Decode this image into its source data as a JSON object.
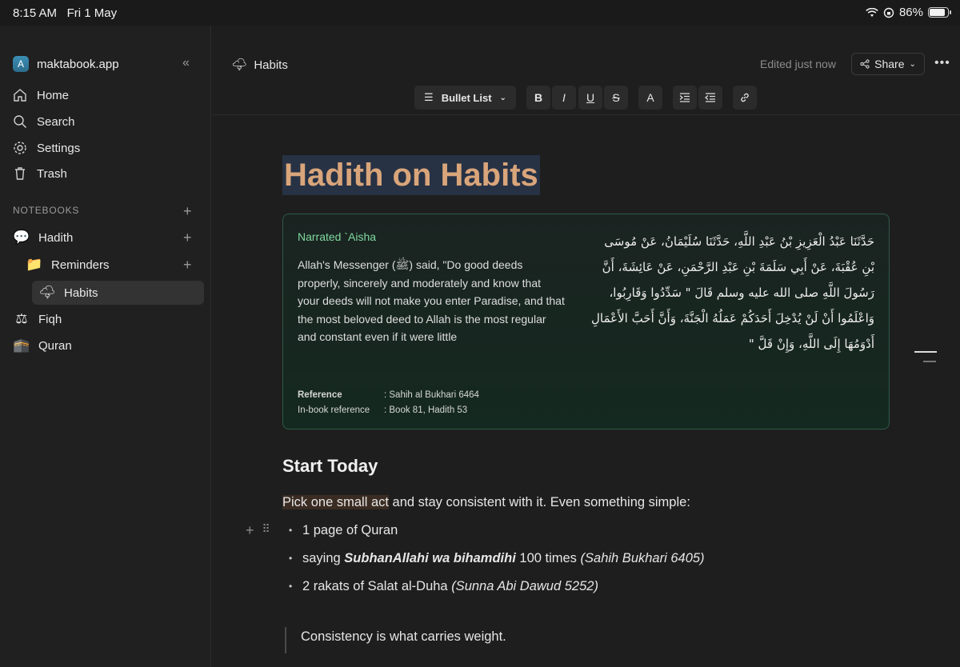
{
  "status": {
    "time": "8:15 AM",
    "date": "Fri 1 May",
    "battery": "86%",
    "battery_level": 0.86
  },
  "sidebar": {
    "workspace_initial": "A",
    "workspace_name": "maktabook.app",
    "nav": [
      {
        "label": "Home",
        "icon": "home-icon"
      },
      {
        "label": "Search",
        "icon": "search-icon"
      },
      {
        "label": "Settings",
        "icon": "gear-icon"
      },
      {
        "label": "Trash",
        "icon": "trash-icon"
      }
    ],
    "notebooks_label": "NOTEBOOKS",
    "tree": [
      {
        "label": "Hadith",
        "emoji": "💬"
      },
      {
        "label": "Reminders",
        "emoji": "📁"
      },
      {
        "label": "Habits",
        "emoji": "🌩"
      },
      {
        "label": "Fiqh",
        "emoji": "⚖"
      },
      {
        "label": "Quran",
        "emoji": "🕋"
      }
    ]
  },
  "header": {
    "page_title": "Habits",
    "edited": "Edited just now",
    "share_label": "Share",
    "toolbar": {
      "list_label": "Bullet List",
      "bold": "B",
      "italic": "I",
      "underline": "U",
      "strike": "S",
      "color": "A"
    }
  },
  "doc": {
    "title": "Hadith on Habits",
    "card": {
      "narrated": "Narrated `Aisha",
      "english": "Allah's Messenger (ﷺ) said, \"Do good deeds properly, sincerely and moderately and know that your deeds will not make you enter Paradise, and that the most beloved deed to Allah is the most regular and constant even if it were little",
      "arabic": "حَدَّثَنَا عَبْدُ الْعَزِيزِ بْنُ عَبْدِ اللَّهِ، حَدَّثَنَا سُلَيْمَانُ، عَنْ مُوسَى بْنِ عُقْبَةَ، عَنْ أَبِي سَلَمَةَ بْنِ عَبْدِ الرَّحْمَنِ، عَنْ عَائِشَةَ، أَنَّ رَسُولَ اللَّهِ صلى الله عليه وسلم قَالَ \" سَدِّدُوا وَقَارِبُوا، وَاعْلَمُوا أَنْ لَنْ يُدْخِلَ أَحَدَكُمْ عَمَلُهُ الْجَنَّةَ، وَأَنَّ أَحَبَّ الأَعْمَالِ أَدْوَمُهَا إِلَى اللَّهِ، وَإِنْ قَلَّ \"",
      "ref_label": "Reference",
      "ref_value": ": Sahih al Bukhari 6464",
      "inbook_label": "In-book reference",
      "inbook_value": ": Book 81, Hadith 53"
    },
    "heading": "Start Today",
    "para_highlight": "Pick one small act",
    "para_rest": " and stay consistent with it. Even something simple:",
    "b1": "1 page of Quran",
    "b2_pre": "saying ",
    "b2_bold": "SubhanAllahi wa bihamdihi",
    "b2_mid": " 100 times ",
    "b2_cite": "(Sahih Bukhari 6405)",
    "b3_pre": "2 rakats of Salat al-Duha ",
    "b3_cite": "(Sunna Abi Dawud 5252)",
    "quote": "Consistency is what carries weight."
  }
}
